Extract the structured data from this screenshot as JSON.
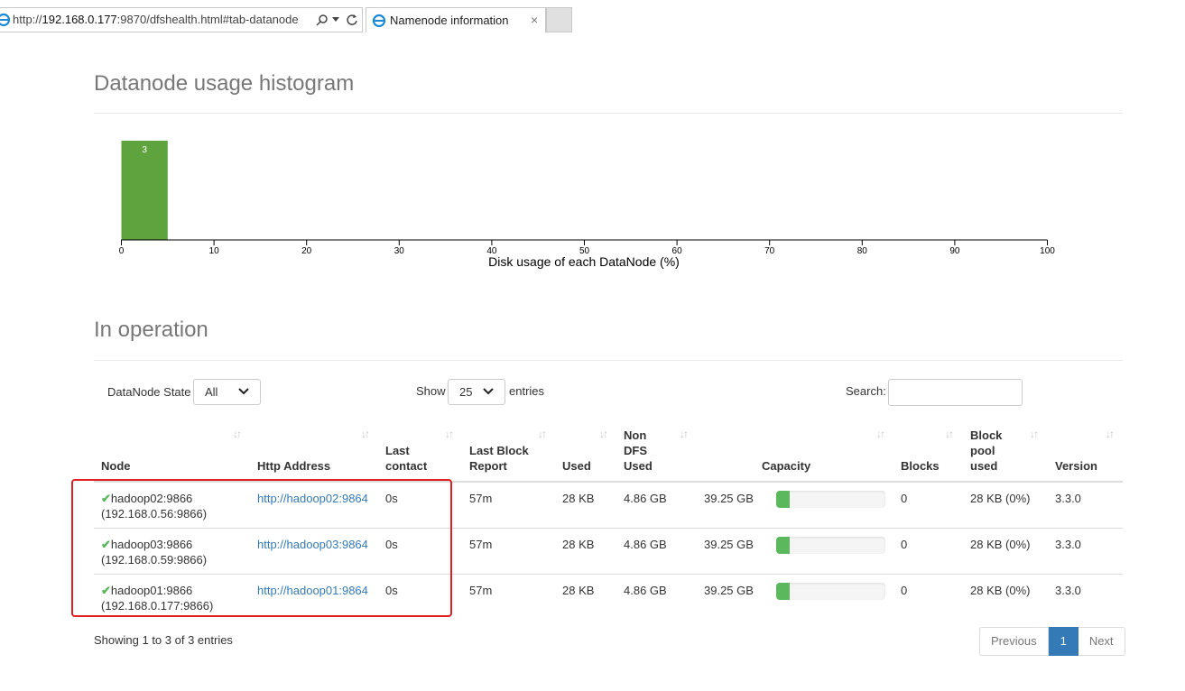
{
  "browser": {
    "url_prefix": "http://",
    "url_host": "192.168.0.177",
    "url_rest": ":9870/dfshealth.html#tab-datanode",
    "tab_title": "Namenode information",
    "tab_close": "×"
  },
  "histogram": {
    "heading": "Datanode usage histogram",
    "chart_data": {
      "type": "bar",
      "xlabel": "Disk usage of each DataNode (%)",
      "ylabel": "",
      "xlim": [
        0,
        100
      ],
      "xticks": [
        0,
        10,
        20,
        30,
        40,
        50,
        60,
        70,
        80,
        90,
        100
      ],
      "bins": [
        {
          "x0": 0,
          "x1": 5,
          "count": 3
        }
      ],
      "bar_color": "#5fa33e"
    }
  },
  "operation": {
    "heading": "In operation",
    "state_label": "DataNode State",
    "state_value": "All",
    "show_label": "Show",
    "show_value": "25",
    "entries_label": "entries",
    "search_label": "Search:",
    "search_value": ""
  },
  "table": {
    "headers": {
      "node": "Node",
      "http": "Http Address",
      "last_contact_1": "Last",
      "last_contact_2": "contact",
      "last_block_1": "Last Block",
      "last_block_2": "Report",
      "used": "Used",
      "non_dfs_1": "Non",
      "non_dfs_2": "DFS",
      "non_dfs_3": "Used",
      "capacity": "Capacity",
      "blocks": "Blocks",
      "pool_1": "Block",
      "pool_2": "pool",
      "pool_3": "used",
      "version": "Version"
    },
    "rows": [
      {
        "node": "hadoop02:9866",
        "ip": "(192.168.0.56:9866)",
        "http": "http://hadoop02:9864",
        "last_contact": "0s",
        "last_block": "57m",
        "used": "28 KB",
        "non_dfs": "4.86 GB",
        "capacity": "39.25 GB",
        "capacity_used_fraction": 0.12,
        "blocks": "0",
        "pool": "28 KB (0%)",
        "version": "3.3.0"
      },
      {
        "node": "hadoop03:9866",
        "ip": "(192.168.0.59:9866)",
        "http": "http://hadoop03:9864",
        "last_contact": "0s",
        "last_block": "57m",
        "used": "28 KB",
        "non_dfs": "4.86 GB",
        "capacity": "39.25 GB",
        "capacity_used_fraction": 0.12,
        "blocks": "0",
        "pool": "28 KB (0%)",
        "version": "3.3.0"
      },
      {
        "node": "hadoop01:9866",
        "ip": "(192.168.0.177:9866)",
        "http": "http://hadoop01:9864",
        "last_contact": "0s",
        "last_block": "57m",
        "used": "28 KB",
        "non_dfs": "4.86 GB",
        "capacity": "39.25 GB",
        "capacity_used_fraction": 0.12,
        "blocks": "0",
        "pool": "28 KB (0%)",
        "version": "3.3.0"
      }
    ],
    "status_icon": "check-icon",
    "highlight_color": "#e02020"
  },
  "footer": {
    "info": "Showing 1 to 3 of 3 entries",
    "previous": "Previous",
    "page": "1",
    "next": "Next"
  }
}
